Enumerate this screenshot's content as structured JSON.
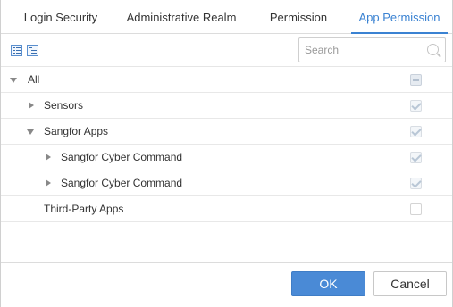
{
  "tabs": [
    {
      "label": "Login Security",
      "active": false
    },
    {
      "label": "Administrative Realm",
      "active": false
    },
    {
      "label": "Permission",
      "active": false
    },
    {
      "label": "App Permission",
      "active": true
    }
  ],
  "toolbar": {
    "expand_all_icon": "expand-all-icon",
    "collapse_all_icon": "collapse-all-icon",
    "search_placeholder": "Search",
    "search_value": ""
  },
  "tree": [
    {
      "label": "All",
      "expanded": true,
      "state": "partial"
    },
    {
      "label": "Sensors",
      "expanded": false,
      "state": "checked-disabled"
    },
    {
      "label": "Sangfor Apps",
      "expanded": true,
      "state": "checked-disabled"
    },
    {
      "label": "Sangfor Cyber Command",
      "expanded": false,
      "state": "checked-disabled"
    },
    {
      "label": "Sangfor Cyber Command",
      "expanded": false,
      "state": "checked-disabled"
    },
    {
      "label": "Third-Party Apps",
      "expanded": null,
      "state": "unchecked"
    }
  ],
  "footer": {
    "ok_label": "OK",
    "cancel_label": "Cancel"
  },
  "colors": {
    "accent": "#3a82d2",
    "primary_button": "#4a8ad6"
  }
}
